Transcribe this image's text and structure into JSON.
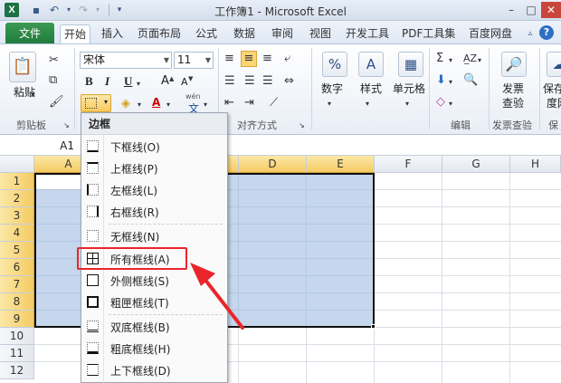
{
  "window": {
    "title": "工作簿1 - Microsoft Excel",
    "app_icon": "X"
  },
  "ribbon_tabs": [
    {
      "label": "文件"
    },
    {
      "label": "开始"
    },
    {
      "label": "插入"
    },
    {
      "label": "页面布局"
    },
    {
      "label": "公式"
    },
    {
      "label": "数据"
    },
    {
      "label": "审阅"
    },
    {
      "label": "视图"
    },
    {
      "label": "开发工具"
    },
    {
      "label": "PDF工具集"
    },
    {
      "label": "百度网盘"
    }
  ],
  "ribbon": {
    "paste_label": "粘贴",
    "clipboard_group": "剪贴板",
    "font_name": "宋体",
    "font_size": "11",
    "bold": "B",
    "italic": "I",
    "underline": "U",
    "font_grow": "A",
    "font_shrink": "A",
    "font_color": "A",
    "phonetic": "wén",
    "phonetic_char": "文",
    "alignment_group": "对齐方式",
    "number_label": "数字",
    "number_symbol": "%",
    "style_label": "样式",
    "cell_label": "单元格",
    "edit_group": "编辑",
    "invoice_label_1": "发票",
    "invoice_label_2": "查验",
    "invoice_group": "发票查验",
    "save_label_1": "保存",
    "save_label_2": "度网",
    "save_group": "保"
  },
  "name_box": "A1",
  "columns": [
    "A",
    "B",
    "C",
    "D",
    "E",
    "F",
    "G",
    "H"
  ],
  "rows": [
    "1",
    "2",
    "3",
    "4",
    "5",
    "6",
    "7",
    "8",
    "9",
    "10",
    "11",
    "12"
  ],
  "border_menu": {
    "header": "边框",
    "items": [
      {
        "label": "下框线(O)",
        "icon": "bottom-border-icon"
      },
      {
        "label": "上框线(P)",
        "icon": "top-border-icon"
      },
      {
        "label": "左框线(L)",
        "icon": "left-border-icon"
      },
      {
        "label": "右框线(R)",
        "icon": "right-border-icon"
      },
      {
        "label": "无框线(N)",
        "icon": "no-border-icon"
      },
      {
        "label": "所有框线(A)",
        "icon": "all-borders-icon"
      },
      {
        "label": "外侧框线(S)",
        "icon": "outside-borders-icon"
      },
      {
        "label": "粗匣框线(T)",
        "icon": "thick-box-border-icon"
      },
      {
        "label": "双底框线(B)",
        "icon": "double-bottom-border-icon"
      },
      {
        "label": "粗底框线(H)",
        "icon": "thick-bottom-border-icon"
      },
      {
        "label": "上下框线(D)",
        "icon": "top-bottom-border-icon"
      }
    ]
  },
  "colors": {
    "file_tab": "#207a3c",
    "selection": "#96b4de",
    "highlight_box": "#e8262b",
    "arrow": "#e8262b"
  }
}
